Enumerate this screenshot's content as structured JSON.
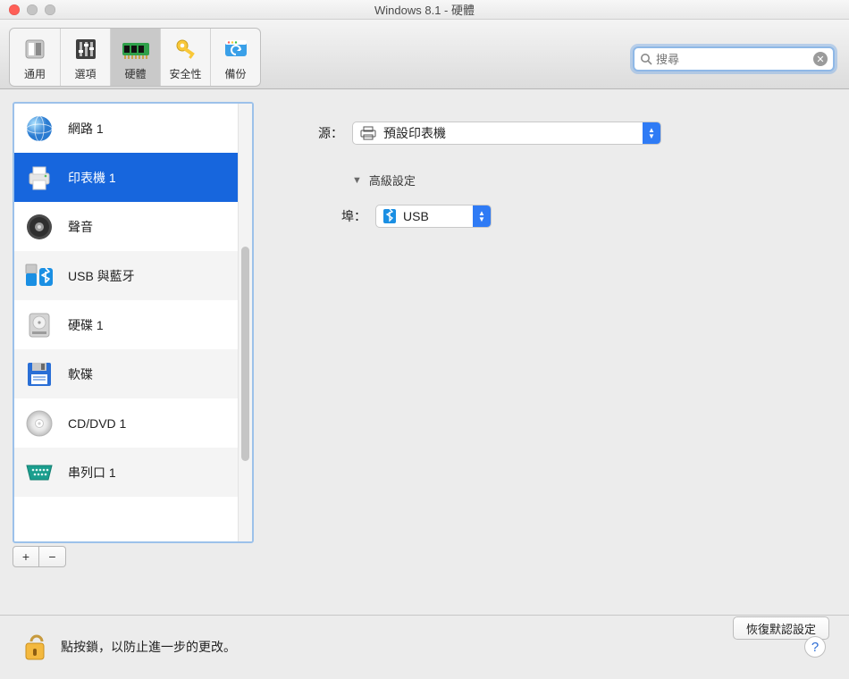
{
  "window": {
    "title": "Windows 8.1 - 硬體"
  },
  "toolbar": {
    "tabs": [
      {
        "label": "通用",
        "icon": "switch-icon"
      },
      {
        "label": "選項",
        "icon": "sliders-icon"
      },
      {
        "label": "硬體",
        "icon": "chip-icon",
        "selected": true
      },
      {
        "label": "安全性",
        "icon": "key-icon"
      },
      {
        "label": "備份",
        "icon": "backup-icon"
      }
    ],
    "search": {
      "placeholder": "搜尋"
    }
  },
  "sidebar": {
    "items": [
      {
        "label": "網路 1",
        "icon": "network-icon"
      },
      {
        "label": "印表機 1",
        "icon": "printer-icon",
        "selected": true
      },
      {
        "label": "聲音",
        "icon": "sound-icon"
      },
      {
        "label": "USB 與藍牙",
        "icon": "usb-bluetooth-icon"
      },
      {
        "label": "硬碟 1",
        "icon": "harddisk-icon"
      },
      {
        "label": "軟碟",
        "icon": "floppy-icon"
      },
      {
        "label": "CD/DVD 1",
        "icon": "cd-icon"
      },
      {
        "label": "串列口 1",
        "icon": "serial-icon"
      }
    ],
    "add_label": "+",
    "remove_label": "−"
  },
  "content": {
    "source_label": "源：",
    "source_value": "預設印表機",
    "advanced_label": "高級設定",
    "port_label": "埠：",
    "port_value": "USB",
    "restore_label": "恢復默認設定"
  },
  "footer": {
    "lock_text": "點按鎖，以防止進一步的更改。",
    "help_label": "?"
  }
}
